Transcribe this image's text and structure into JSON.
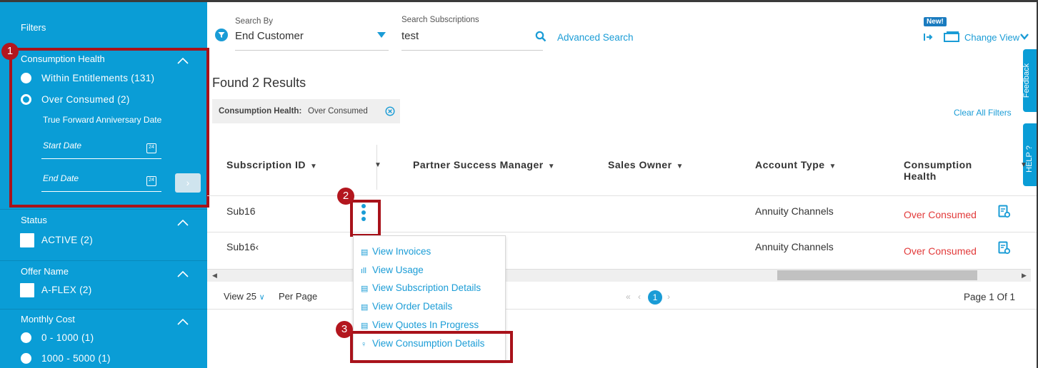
{
  "sidebar": {
    "title": "Filters",
    "consumption_health": {
      "label": "Consumption Health",
      "options": [
        "Within Entitlements (131)",
        "Over Consumed (2)"
      ]
    },
    "tf_label": "True Forward Anniversary Date",
    "start_date_placeholder": "Start Date",
    "end_date_placeholder": "End Date",
    "status": {
      "label": "Status",
      "option": "ACTIVE (2)"
    },
    "offer_name": {
      "label": "Offer Name",
      "option": "A-FLEX (2)"
    },
    "monthly_cost": {
      "label": "Monthly Cost",
      "options": [
        "0 - 1000 (1)",
        "1000 - 5000 (1)"
      ]
    },
    "go_icon": "chevron-right-icon"
  },
  "search": {
    "by_label": "Search By",
    "by_value": "End Customer",
    "sub_label": "Search Subscriptions",
    "sub_value": "test",
    "advanced": "Advanced Search"
  },
  "topbar": {
    "new_badge": "New!",
    "change_view": "Change View"
  },
  "results": {
    "title": "Found 2 Results",
    "chip_label": "Consumption Health:",
    "chip_value": "Over Consumed",
    "clear_all": "Clear All Filters"
  },
  "table": {
    "headers": [
      "Subscription ID",
      "Partner Success Manager",
      "Sales Owner",
      "Account Type",
      "Consumption",
      "Health"
    ],
    "rows": [
      {
        "id": "Sub16",
        "account_type": "Annuity Channels",
        "health": "Over Consumed"
      },
      {
        "id": "Sub16‹",
        "account_type": "Annuity Channels",
        "health": "Over Consumed"
      }
    ]
  },
  "context_menu": [
    "View Invoices",
    "View Usage",
    "View Subscription Details",
    "View Order Details",
    "View Quotes In Progress",
    "View Consumption Details"
  ],
  "pagination": {
    "view": "View 25",
    "per_page": "Per Page",
    "current": "1",
    "page_info": "Page 1 Of 1"
  },
  "side_tabs": {
    "feedback": "Feedback",
    "help": "HELP ?"
  },
  "callouts": [
    "1",
    "2",
    "3"
  ],
  "colors": {
    "accent": "#0a9dd6",
    "link": "#1a9cd6",
    "alert": "#e23b3b",
    "callout": "#b3161e"
  }
}
